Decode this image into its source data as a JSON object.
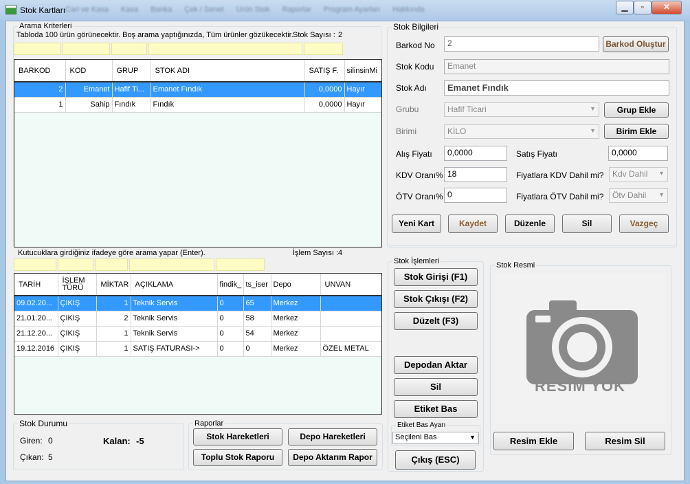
{
  "window": {
    "title": "Stok Kartları",
    "menu": [
      "Cari ve Kasa",
      "Kasa",
      "Banka",
      "Çek / Senet",
      "Ürün Stok",
      "Raporlar",
      "Program Ayarları",
      "Hakkında"
    ]
  },
  "search": {
    "legend": "Arama Kriterleri",
    "info": "Tabloda 100 ürün görünecektir. Boş arama yaptığınızda, Tüm ürünler gözükecektir.",
    "count_label": "Stok Sayısı :",
    "count": "2"
  },
  "products": {
    "columns": [
      "BARKOD",
      "KOD",
      "GRUP",
      "STOK ADI",
      "SATIŞ F.",
      "silinsinMi"
    ],
    "rows": [
      [
        "2",
        "Emanet",
        "Hafif Ti...",
        "Emanet Fındık",
        "0,0000",
        "Hayır"
      ],
      [
        "1",
        "Sahip",
        "Fındık",
        "Fındık",
        "0,0000",
        "Hayır"
      ]
    ]
  },
  "moves_search": {
    "info": "Kutucuklara girdiğiniz ifadeye göre arama yapar (Enter).",
    "count_label": "İşlem Sayısı :",
    "count": "4"
  },
  "moves": {
    "columns": [
      "TARİH",
      "İŞLEM TÜRÜ",
      "MİKTAR",
      "AÇIKLAMA",
      "findik_",
      "ts_iser",
      "Depo",
      "UNVAN"
    ],
    "rows": [
      [
        "09.02.20...",
        "ÇIKIŞ",
        "1",
        "Teknik Servis",
        "0",
        "65",
        "Merkez",
        ""
      ],
      [
        "21.01.20...",
        "ÇIKIŞ",
        "2",
        "Teknik Servis",
        "0",
        "58",
        "Merkez",
        ""
      ],
      [
        "21.12.20...",
        "ÇIKIŞ",
        "1",
        "Teknik Servis",
        "0",
        "54",
        "Merkez",
        ""
      ],
      [
        "19.12.2016",
        "ÇIKIŞ",
        "1",
        "SATIŞ FATURASI->",
        "0",
        "0",
        "Merkez",
        "ÖZEL METAL"
      ]
    ]
  },
  "stock_status": {
    "legend": "Stok Durumu",
    "in_label": "Giren:",
    "in": "0",
    "out_label": "Çıkan:",
    "out": "5",
    "remain_label": "Kalan:",
    "remain": "-5"
  },
  "reports": {
    "legend": "Raporlar",
    "stock_moves": "Stok Hareketleri",
    "depot_moves": "Depo Hareketleri",
    "bulk_report": "Toplu Stok Raporu",
    "transfer_report": "Depo Aktarım Rapor"
  },
  "info": {
    "legend": "Stok Bilgileri",
    "barcode_label": "Barkod No",
    "barcode": "2",
    "make_barcode": "Barkod Oluştur",
    "code_label": "Stok Kodu",
    "code": "Emanet",
    "name_label": "Stok Adı",
    "name": "Emanet Fındık",
    "group_label": "Grubu",
    "group": "Hafif Ticari",
    "add_group": "Grup Ekle",
    "unit_label": "Birimi",
    "unit": "KİLO",
    "add_unit": "Birim Ekle",
    "buy_label": "Alış Fiyatı",
    "buy": "0,0000",
    "sell_label": "Satış Fiyatı",
    "sell": "0,0000",
    "kdv_label": "KDV Oranı%",
    "kdv": "18",
    "kdv_incl_label": "Fiyatlara KDV Dahil mi?",
    "kdv_incl": "Kdv Dahil",
    "otv_label": "ÖTV Oranı%",
    "otv": "0",
    "otv_incl_label": "Fiyatlara ÖTV Dahil mi?",
    "otv_incl": "Ötv Dahil"
  },
  "actions": {
    "new": "Yeni Kart",
    "save": "Kaydet",
    "edit": "Düzenle",
    "delete": "Sil",
    "cancel": "Vazgeç"
  },
  "ops": {
    "legend": "Stok İşlemleri",
    "in": "Stok Girişi (F1)",
    "out": "Stok Çıkışı (F2)",
    "fix": "Düzelt (F3)",
    "transfer": "Depodan Aktar",
    "delete": "Sil",
    "print": "Etiket Bas",
    "print_legend": "Etiket Bas Ayarı",
    "print_setting": "Seçileni Bas",
    "exit": "Çıkış (ESC)"
  },
  "image": {
    "legend": "Stok Resmi",
    "placeholder": "RESİM YOK",
    "add": "Resim Ekle",
    "remove": "Resim Sil"
  },
  "colors": {
    "selected_row": "#3399ff",
    "search_box": "#fdfcc4",
    "grid_bg": "#f0fbf7"
  }
}
